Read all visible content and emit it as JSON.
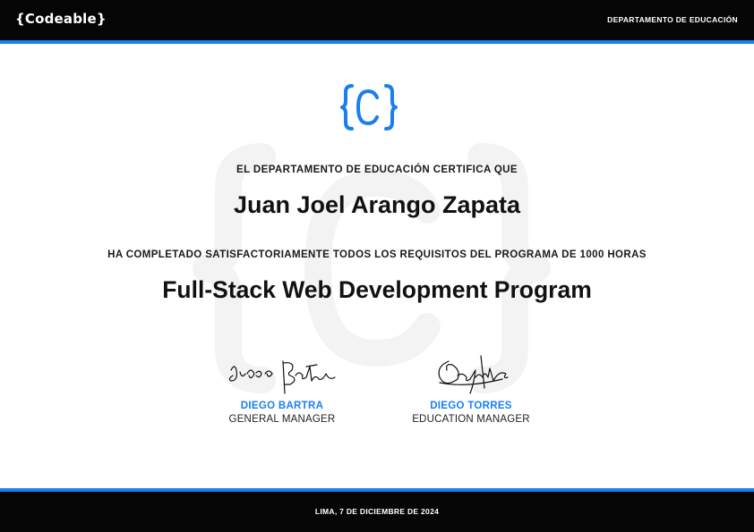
{
  "header": {
    "brand": "{Codeable}",
    "department": "DEPARTAMENTO DE EDUCACIÓN"
  },
  "certificate": {
    "certifies_line": "EL DEPARTAMENTO DE EDUCACIÓN CERTIFICA QUE",
    "recipient": "Juan Joel Arango Zapata",
    "completed_line": "HA COMPLETADO SATISFACTORIAMENTE TODOS LOS REQUISITOS DEL PROGRAMA DE 1000 HORAS",
    "program": "Full-Stack Web Development Program"
  },
  "signatures": [
    {
      "name": "DIEGO BARTRA",
      "role": "GENERAL MANAGER"
    },
    {
      "name": "DIEGO TORRES",
      "role": "EDUCATION MANAGER"
    }
  ],
  "footer": {
    "date": "LIMA, 7 DE DICIEMBRE DE 2024"
  },
  "colors": {
    "accent": "#1b7ef0",
    "bar": "#050505",
    "watermark": "#f3f3f3"
  }
}
